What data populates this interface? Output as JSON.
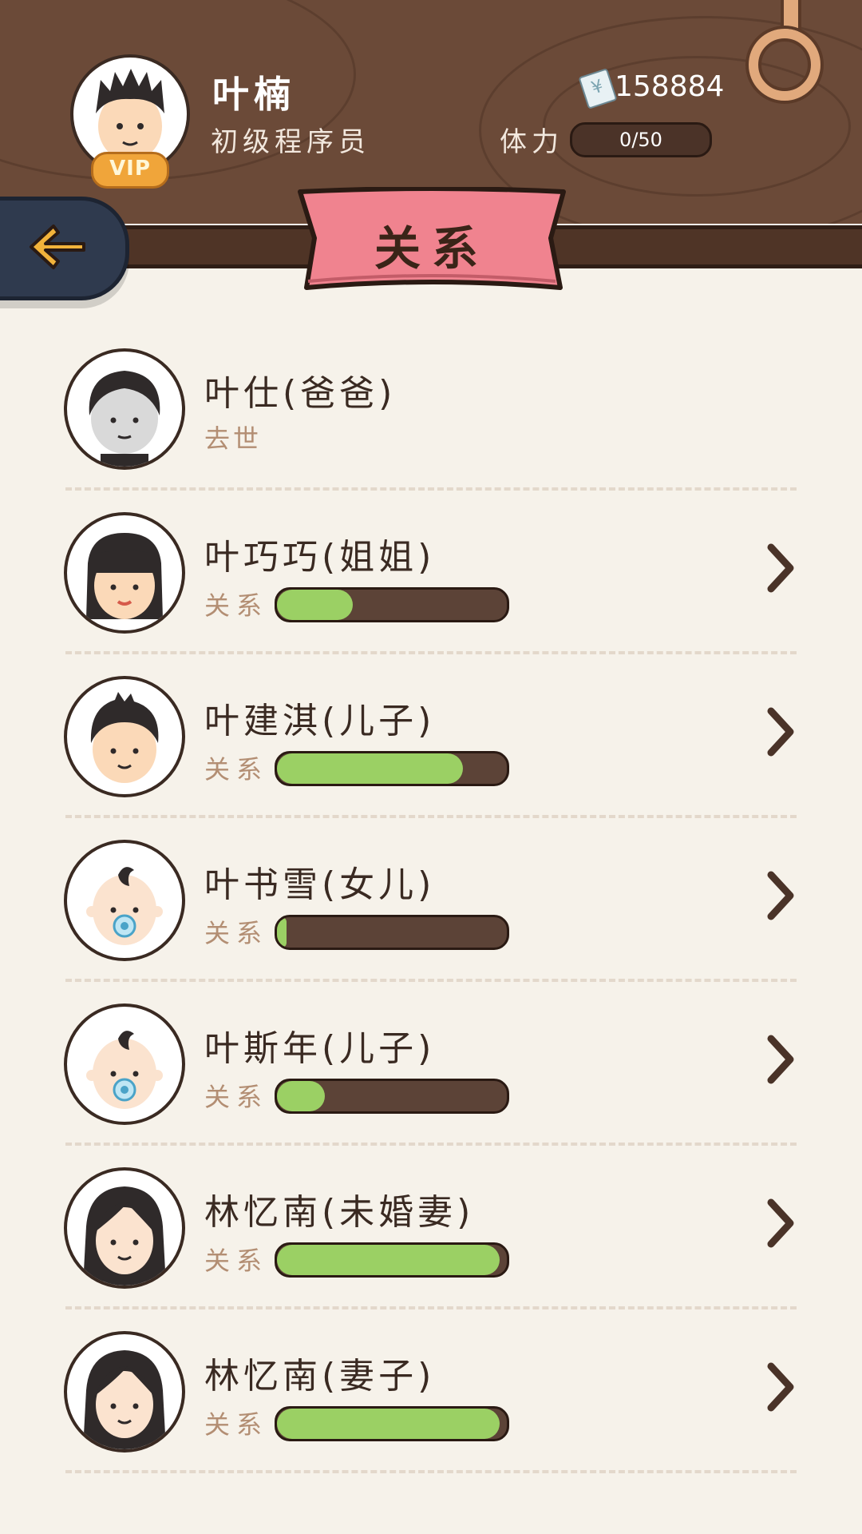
{
  "header": {
    "player_name": "叶楠",
    "player_title": "初级程序员",
    "vip_label": "VIP",
    "money": "158884",
    "stamina_label": "体力",
    "stamina_value": "0/50"
  },
  "page_title": "关系",
  "relations": [
    {
      "name": "叶仕(爸爸)",
      "status": "去世",
      "relation": null,
      "avatar": "father",
      "clickable": false
    },
    {
      "name": "叶巧巧(姐姐)",
      "status": null,
      "relation_label": "关系",
      "relation": 0.33,
      "avatar": "sister",
      "clickable": true
    },
    {
      "name": "叶建淇(儿子)",
      "status": null,
      "relation_label": "关系",
      "relation": 0.81,
      "avatar": "son",
      "clickable": true
    },
    {
      "name": "叶书雪(女儿)",
      "status": null,
      "relation_label": "关系",
      "relation": 0.04,
      "avatar": "baby",
      "clickable": true
    },
    {
      "name": "叶斯年(儿子)",
      "status": null,
      "relation_label": "关系",
      "relation": 0.21,
      "avatar": "baby",
      "clickable": true
    },
    {
      "name": "林忆南(未婚妻)",
      "status": null,
      "relation_label": "关系",
      "relation": 0.97,
      "avatar": "woman",
      "clickable": true
    },
    {
      "name": "林忆南(妻子)",
      "status": null,
      "relation_label": "关系",
      "relation": 0.97,
      "avatar": "woman",
      "clickable": true
    }
  ],
  "colors": {
    "header_wood": "#6b4a38",
    "banner_pink": "#f0838f",
    "bar_fill": "#9bd064",
    "bar_track": "#5c4337",
    "background": "#f6f2ea"
  }
}
